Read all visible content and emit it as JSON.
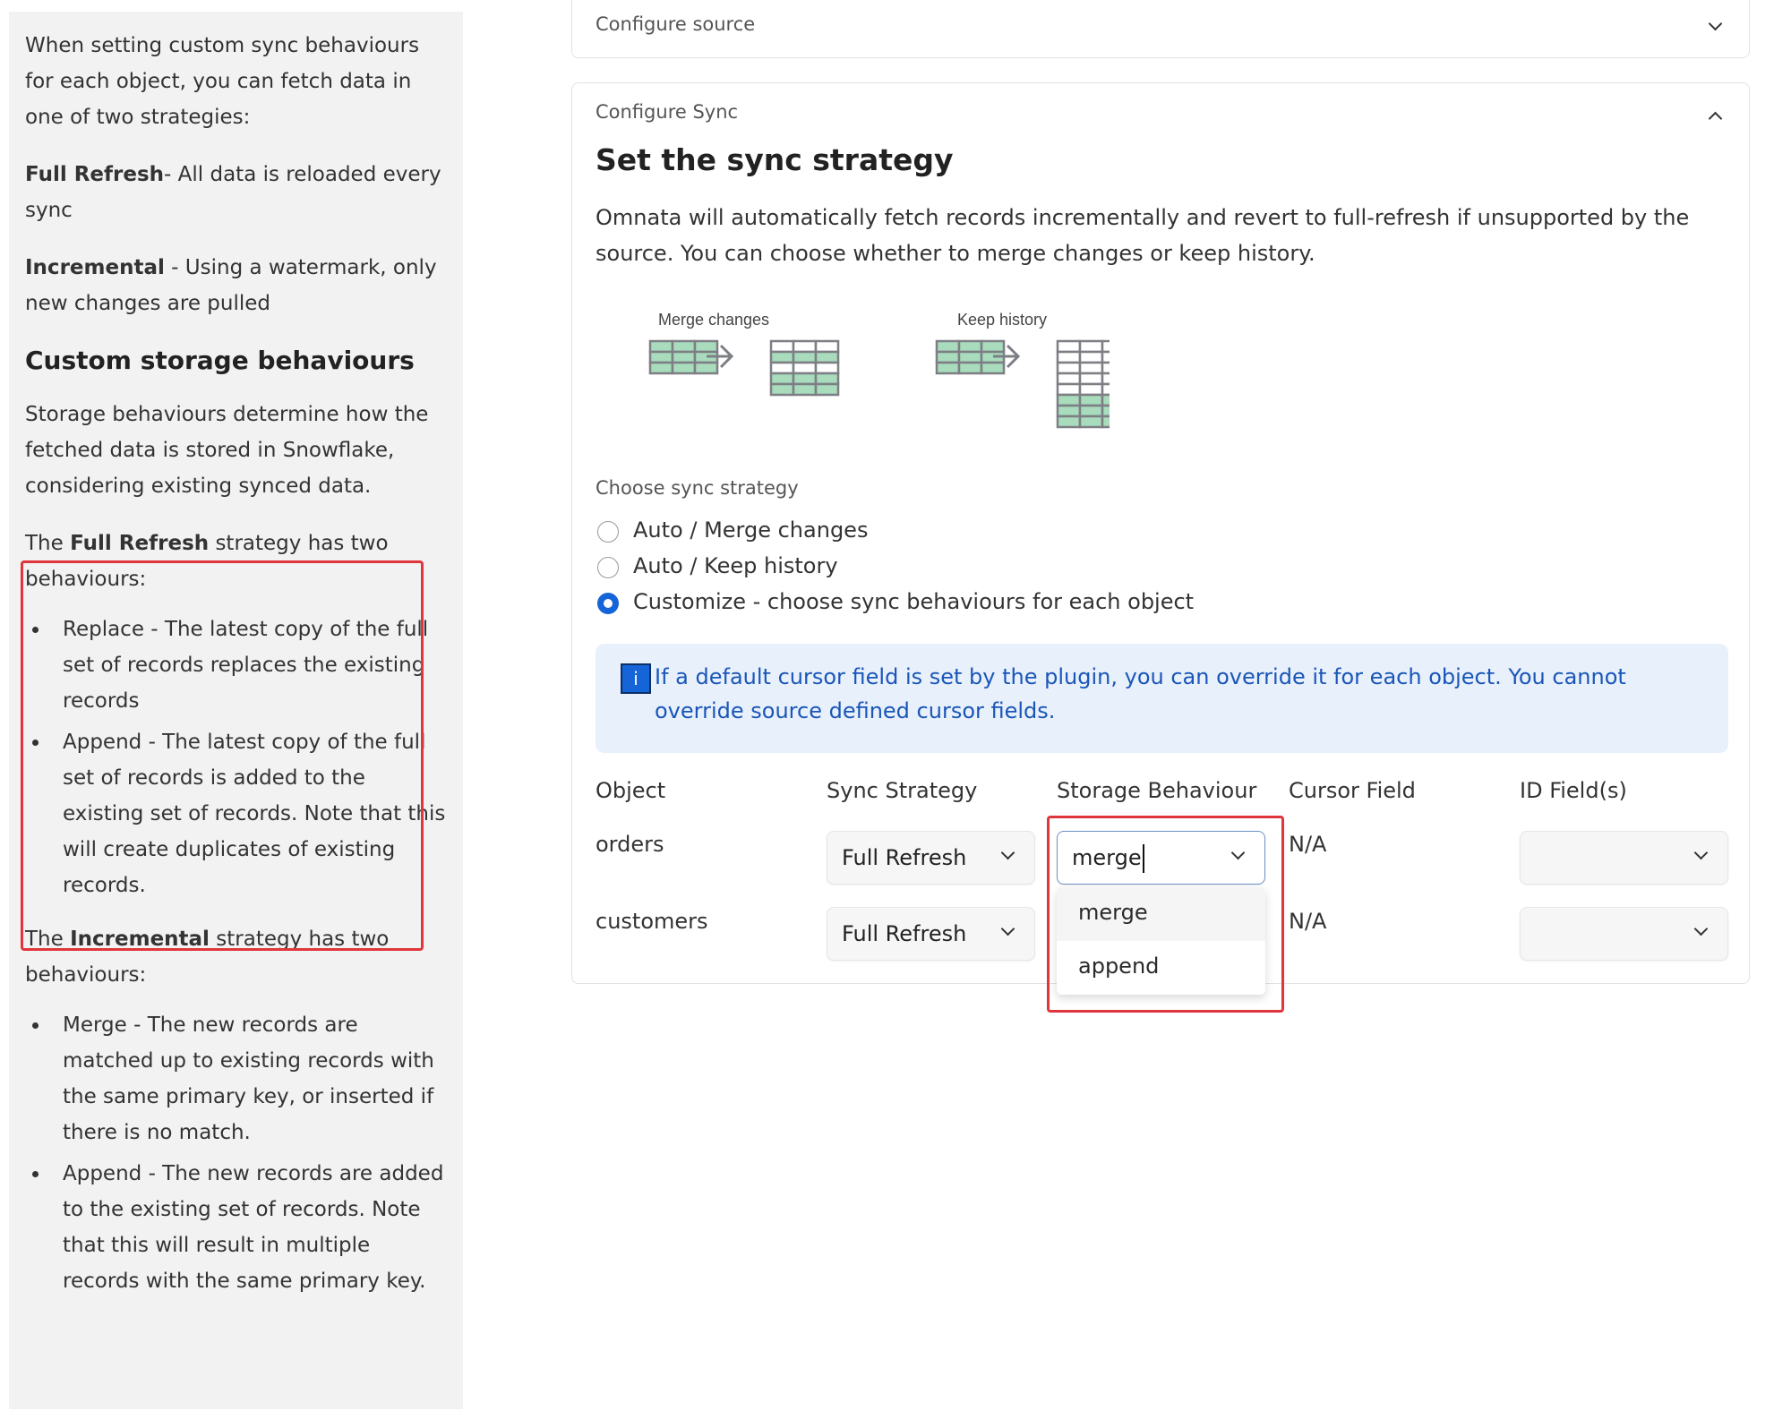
{
  "sidebar": {
    "intro": "When setting custom sync behaviours for each object, you can fetch data in one of two strategies:",
    "full_refresh_term": "Full Refresh",
    "full_refresh_desc": "- All data is reloaded every sync",
    "incremental_term": "Incremental",
    "incremental_desc": " - Using a watermark, only new changes are pulled",
    "storage_heading": "Custom storage behaviours",
    "storage_desc": "Storage behaviours determine how the fetched data is stored in Snowflake, considering existing synced data.",
    "fr_pre": "The ",
    "fr_strategy": "Full Refresh",
    "fr_post": " strategy has two behaviours:",
    "fr_items": [
      "Replace - The latest copy of the full set of records replaces the existing records",
      "Append - The latest copy of the full set of records is added to the existing set of records. Note that this will create duplicates of existing records."
    ],
    "inc_pre": "The ",
    "inc_strategy": "Incremental",
    "inc_post": " strategy has two behaviours:",
    "inc_items": [
      "Merge - The new records are matched up to existing records with the same primary key, or inserted if there is no match.",
      "Append - The new records are added to the existing set of records. Note that this will result in multiple records with the same primary key."
    ]
  },
  "configure_source": {
    "label": "Configure source",
    "state": "collapsed"
  },
  "configure_sync": {
    "label": "Configure Sync",
    "state": "expanded",
    "title": "Set the sync strategy",
    "description": "Omnata will automatically fetch records incrementally and revert to full-refresh if unsupported by the source. You can choose whether to merge changes or keep history.",
    "diagram": {
      "merge_label": "Merge changes",
      "history_label": "Keep history"
    },
    "strategy_label": "Choose sync strategy",
    "strategies": [
      {
        "label": "Auto / Merge changes",
        "selected": false
      },
      {
        "label": "Auto / Keep history",
        "selected": false
      },
      {
        "label": "Customize - choose sync behaviours for each object",
        "selected": true
      }
    ],
    "info": "If a default cursor field is set by the plugin, you can override it for each object. You cannot override source defined cursor fields.",
    "table": {
      "headers": [
        "Object",
        "Sync Strategy",
        "Storage Behaviour",
        "Cursor Field",
        "ID Field(s)"
      ],
      "rows": [
        {
          "object": "orders",
          "sync_strategy": "Full Refresh",
          "storage_behaviour": "merge",
          "cursor_field": "N/A",
          "id_fields": ""
        },
        {
          "object": "customers",
          "sync_strategy": "Full Refresh",
          "storage_behaviour": "",
          "cursor_field": "N/A",
          "id_fields": ""
        }
      ],
      "dropdown_options": [
        "merge",
        "append"
      ]
    }
  },
  "colors": {
    "accent": "#1565d8",
    "highlight": "#e0353d",
    "info_bg": "#e8f0fb",
    "info_text": "#1a56b8",
    "diagram_green": "#a8dcbc"
  }
}
